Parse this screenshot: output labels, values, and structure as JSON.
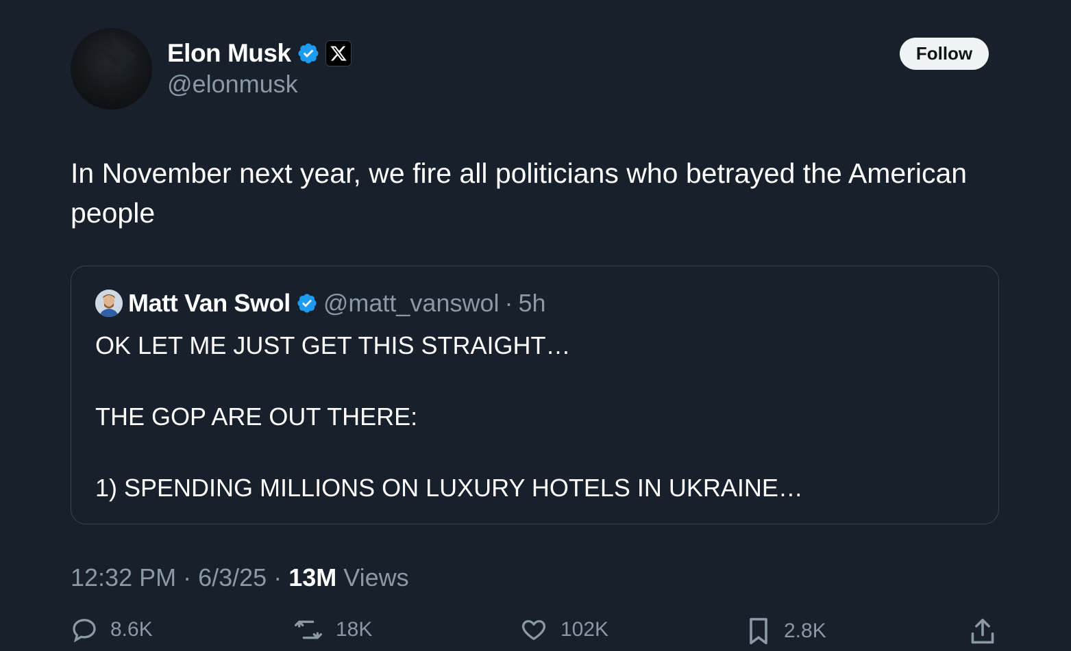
{
  "author": {
    "name": "Elon Musk",
    "handle": "@elonmusk",
    "follow_label": "Follow"
  },
  "tweet": {
    "text": "In November next year, we fire all politicians who betrayed the American people"
  },
  "quoted": {
    "name": "Matt Van Swol",
    "handle": "@matt_vanswol",
    "separator": "·",
    "time": "5h",
    "lines": [
      "OK LET ME JUST GET THIS STRAIGHT…",
      "THE GOP ARE OUT THERE:",
      "1) SPENDING MILLIONS ON LUXURY HOTELS IN UKRAINE…"
    ]
  },
  "meta": {
    "time": "12:32 PM",
    "dot1": "·",
    "date": "6/3/25",
    "dot2": "·",
    "views_count": "13M",
    "views_label": "Views"
  },
  "actions": {
    "replies": "8.6K",
    "reposts": "18K",
    "likes": "102K",
    "bookmarks": "2.8K"
  },
  "colors": {
    "background": "#17202b",
    "verified": "#1d9bf0",
    "muted_text": "#8b98a5"
  }
}
